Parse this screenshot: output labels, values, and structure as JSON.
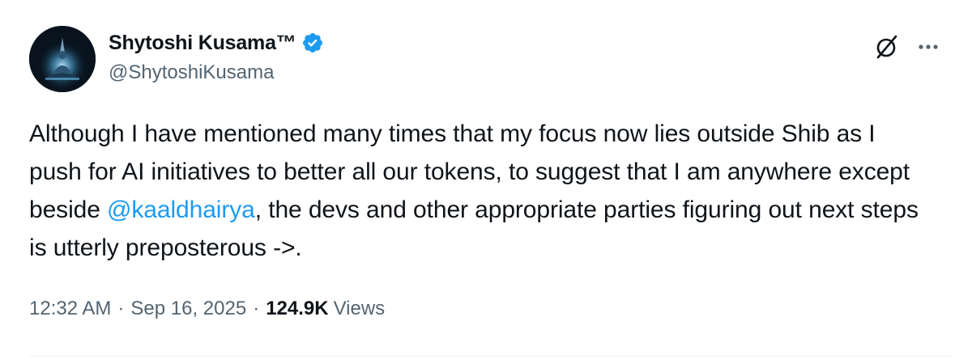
{
  "author": {
    "display_name": "Shytoshi Kusama™",
    "handle": "@ShytoshiKusama",
    "verified": true
  },
  "tweet": {
    "text_part1": "Although I have mentioned many times that my focus now lies outside Shib as I push for AI initiatives to better all our tokens, to suggest that I am anywhere except beside ",
    "mention": "@kaaldhairya",
    "text_part2": ", the devs and other appropriate parties figuring out next steps is utterly preposterous ->."
  },
  "meta": {
    "time": "12:32 AM",
    "separator": "·",
    "date": "Sep 16, 2025",
    "views_count": "124.9K",
    "views_label": "Views"
  },
  "icons": {
    "verified": "verified-badge-icon",
    "grok": "grok-icon",
    "more": "more-options-icon"
  },
  "colors": {
    "accent": "#1d9bf0",
    "text": "#0f1419",
    "secondary": "#536471"
  }
}
